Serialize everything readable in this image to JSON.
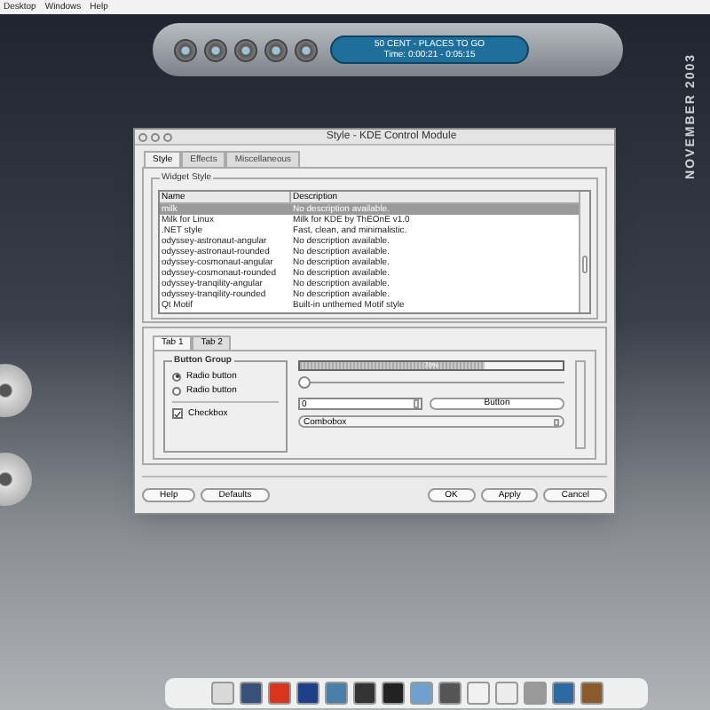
{
  "menu_bar": [
    "Desktop",
    "Windows",
    "Help"
  ],
  "player": {
    "track": "50 CENT - PLACES TO GO",
    "time": "Time: 0:00:21 - 0:05:15"
  },
  "desktop_caption": "NOVEMBER 2003",
  "window": {
    "title": "Style - KDE Control Module",
    "tabs": [
      {
        "label": "Style",
        "selected": true
      },
      {
        "label": "Effects",
        "selected": false
      },
      {
        "label": "Miscellaneous",
        "selected": false
      }
    ],
    "group_title": "Widget Style",
    "table": {
      "columns": [
        "Name",
        "Description"
      ],
      "rows": [
        {
          "name": "milk",
          "description": "No description available.",
          "selected": true
        },
        {
          "name": "Milk for Linux",
          "description": "Milk for KDE by ThEOnE v1.0",
          "selected": false
        },
        {
          "name": ".NET style",
          "description": "Fast, clean, and minimalistic.",
          "selected": false
        },
        {
          "name": "odyssey-astronaut-angular",
          "description": "No description available.",
          "selected": false
        },
        {
          "name": "odyssey-astronaut-rounded",
          "description": "No description available.",
          "selected": false
        },
        {
          "name": "odyssey-cosmonaut-angular",
          "description": "No description available.",
          "selected": false
        },
        {
          "name": "odyssey-cosmonaut-rounded",
          "description": "No description available.",
          "selected": false
        },
        {
          "name": "odyssey-tranqility-angular",
          "description": "No description available.",
          "selected": false
        },
        {
          "name": "odyssey-tranqility-rounded",
          "description": "No description available.",
          "selected": false
        },
        {
          "name": "Qt Motif",
          "description": "Built-in unthemed Motif style",
          "selected": false
        }
      ]
    },
    "preview": {
      "tabs": [
        {
          "label": "Tab 1",
          "selected": true
        },
        {
          "label": "Tab 2",
          "selected": false
        }
      ],
      "button_group": "Button Group",
      "radios": [
        {
          "label": "Radio button",
          "selected": true
        },
        {
          "label": "Radio button",
          "selected": false
        }
      ],
      "checkbox": {
        "label": "Checkbox",
        "checked": true
      },
      "progress": {
        "level": 0.7,
        "reading": "70%"
      },
      "slider": {
        "level": 0.0
      },
      "spinbox": "0",
      "button": "Button",
      "combobox": "Combobox"
    },
    "buttons_left": [
      "Help",
      "Defaults"
    ],
    "buttons_right": [
      "OK",
      "Apply",
      "Cancel"
    ]
  }
}
